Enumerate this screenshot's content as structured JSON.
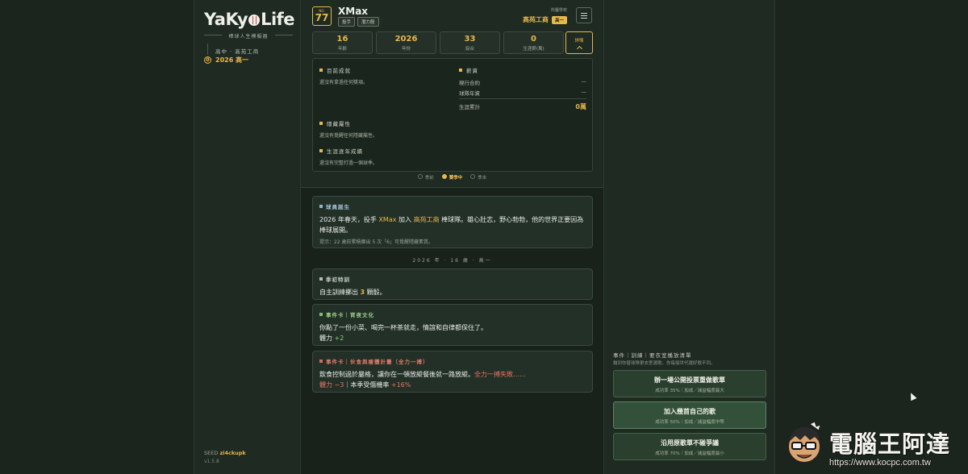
{
  "logo": {
    "pre": "YaKy",
    "post": "Life",
    "subtitle": "棒球人生模擬器"
  },
  "sidebar": {
    "stage": "高中 · 高苑工商",
    "year_index": "0",
    "year_label": "2026 高一",
    "seed_label": "SEED",
    "seed_value": "zi4ckupk",
    "version": "v1.5.8"
  },
  "player": {
    "no_label": "NO.",
    "number": "77",
    "name": "XMax",
    "tags": [
      "投手",
      "潛力股"
    ],
    "team_label": "所屬學校",
    "team_name": "高苑工商",
    "grade_badge": "高一"
  },
  "stats": [
    {
      "value": "16",
      "label": "年齡"
    },
    {
      "value": "2026",
      "label": "年份"
    },
    {
      "value": "33",
      "label": "綜合"
    },
    {
      "value": "0",
      "label": "生涯薪(萬)"
    }
  ],
  "detail_button": "詳情",
  "panel": {
    "achievements_title": "目前成就",
    "achievements_text": "還沒有拿過任何獎項。",
    "salary_title": "薪資",
    "salary_rows": [
      {
        "label": "現行合約",
        "value": "—"
      },
      {
        "label": "球隊年資",
        "value": "—"
      }
    ],
    "salary_total_label": "生涯累計",
    "salary_total_value": "0萬",
    "hidden_title": "隱藏屬性",
    "hidden_text": "還沒有覺醒任何隱藏屬性。",
    "career_title": "生涯逐年成績",
    "career_text": "還沒有完整打過一個球季。"
  },
  "season_tabs": [
    "季前",
    "賽季中",
    "季末"
  ],
  "season_active": "賽季中",
  "feed": {
    "birth": {
      "title": "球員誕生",
      "text_pre": "2026 年春天，投手 ",
      "name": "XMax",
      "text_mid": " 加入 ",
      "team": "高苑工商",
      "text_post": " 棒球隊。雄心壯志，野心勃勃，他的世界正要因為棒球展開。",
      "hint": "提示：22 歲前累積擲出 5 次「6」可覺醒隱藏素質。"
    },
    "divider": "2026 年 · 16 歲 · 高一",
    "training": {
      "title": "季初特訓",
      "text_pre": "自主訓練擲出 ",
      "dice": "3",
      "text_post": " 顆骰。"
    },
    "event1": {
      "title": "事件卡｜宵夜文化",
      "text": "你點了一份小菜、喝完一杯茶就走，情誼和自律都保住了。",
      "stat_label": "體力 ",
      "stat_value": "+2"
    },
    "event2": {
      "title": "事件卡｜伙食與瘦體計畫（全力一搏）",
      "text_pre": "飲食控制過於嚴格，讓你在一頓放縱餐後就一路放縱。",
      "fail": "全力一搏失敗……",
      "effect1": "體力 −3",
      "sep": "｜本季受傷機率 ",
      "effect2": "+16%"
    }
  },
  "actions": {
    "header": "事件｜訓練｜要衣室播放清單",
    "sub": "輪到你替球隊更衣室選歌，你每個世代選好歌不同。",
    "items": [
      {
        "name": "辦一場公開投票重做歌單",
        "meta": "成功率 35%｜加成／減益幅度最大"
      },
      {
        "name": "加入幾首自己的歌",
        "meta": "成功率 50%｜加成／減益幅度中等"
      },
      {
        "name": "沿用原歌單不碰爭議",
        "meta": "成功率 70%｜加成／減益幅度最小"
      }
    ]
  },
  "watermark": {
    "title": "電腦王阿達",
    "url": "https://www.kocpc.com.tw"
  },
  "colors": {
    "accent": "#e8b84a",
    "background": "#1b241d",
    "panel": "#1e2a22",
    "positive": "#8fd07a",
    "negative": "#e8745f"
  }
}
